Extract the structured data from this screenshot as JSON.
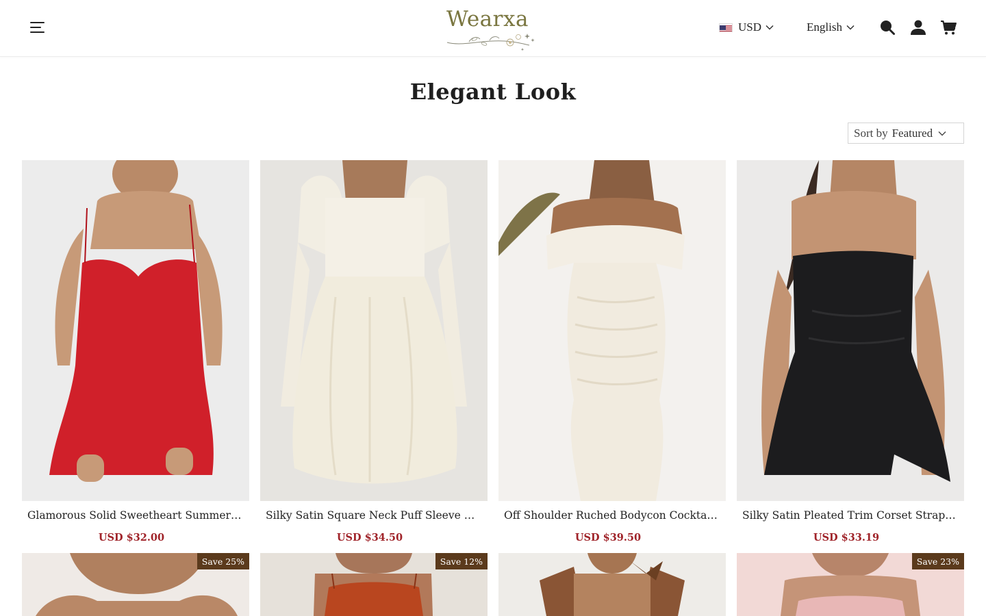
{
  "header": {
    "logo_text": "Wearxa",
    "currency": "USD",
    "language": "English",
    "icons": [
      "menu-icon",
      "search-icon",
      "account-icon",
      "cart-icon"
    ]
  },
  "page": {
    "title": "Elegant Look"
  },
  "sort": {
    "prefix": "Sort by",
    "value": "Featured"
  },
  "colors": {
    "price": "#a0242a",
    "badge_bg": "#5b3a1c",
    "logo": "#7a7640"
  },
  "products": [
    {
      "name": "Glamorous Solid Sweetheart Summer J...",
      "price": "USD $32.00",
      "color": "red dress"
    },
    {
      "name": "Silky Satin Square Neck Puff Sleeve Ba...",
      "price": "USD $34.50",
      "color": "cream dress"
    },
    {
      "name": "Off Shoulder Ruched Bodycon Cocktail ...",
      "price": "USD $39.50",
      "color": "ivory dress"
    },
    {
      "name": "Silky Satin Pleated Trim Corset Straples...",
      "price": "USD $33.19",
      "color": "black dress"
    }
  ],
  "products_row2": [
    {
      "badge": "Save 25%"
    },
    {
      "badge": "Save 12%"
    },
    {
      "badge": ""
    },
    {
      "badge": "Save 23%"
    }
  ]
}
